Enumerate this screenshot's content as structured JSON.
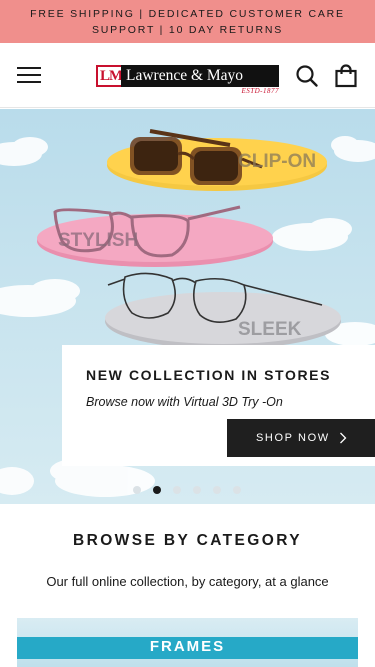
{
  "announcement": {
    "text": "FREE SHIPPING | DEDICATED CUSTOMER CARE SUPPORT | 10 DAY RETURNS"
  },
  "header": {
    "menu_icon": "hamburger-menu-icon",
    "logo": {
      "monogram": "LM",
      "brand": "Lawrence & Mayo",
      "estd": "ESTD-1877"
    },
    "search_icon": "search-icon",
    "cart_icon": "shopping-bag-icon"
  },
  "hero": {
    "tags": [
      "CLIP-ON",
      "STYLISH",
      "SLEEK"
    ],
    "title": "NEW COLLECTION IN STORES",
    "subtitle": "Browse now with Virtual 3D Try -On",
    "cta_label": "SHOP NOW",
    "cta_icon": "chevron-right-icon",
    "slides_total": 6,
    "active_slide": 1
  },
  "browse": {
    "title": "BROWSE BY CATEGORY",
    "subtitle": "Our full online collection, by category, at a glance",
    "first_category": "FRAMES"
  },
  "colors": {
    "announcement_bg": "#f08f8c",
    "brand_red": "#c8102e",
    "button_dark": "#1f1f1f",
    "category_band": "#26a9c7"
  }
}
